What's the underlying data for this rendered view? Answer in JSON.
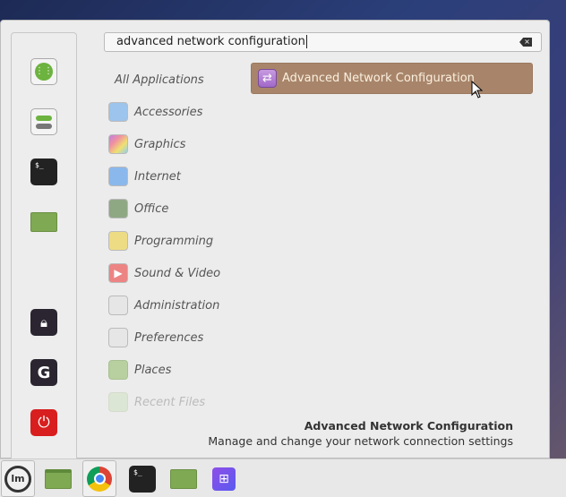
{
  "search": {
    "value": "advanced network configuration"
  },
  "categories": [
    {
      "label": "All Applications",
      "icon": "none"
    },
    {
      "label": "Accessories",
      "icon": "scissors-icon",
      "color": "#9cc4ec"
    },
    {
      "label": "Graphics",
      "icon": "palette-icon",
      "color": "#d890d0"
    },
    {
      "label": "Internet",
      "icon": "cloud-icon",
      "color": "#8ab8ec"
    },
    {
      "label": "Office",
      "icon": "document-icon",
      "color": "#8fa884"
    },
    {
      "label": "Programming",
      "icon": "ruler-icon",
      "color": "#eedc84"
    },
    {
      "label": "Sound & Video",
      "icon": "play-icon",
      "color": "#ec8484"
    },
    {
      "label": "Administration",
      "icon": "toggle-icon",
      "color": "#e6e6e6"
    },
    {
      "label": "Preferences",
      "icon": "toggle-icon",
      "color": "#e6e6e6"
    },
    {
      "label": "Places",
      "icon": "folder-icon",
      "color": "#b8d0a0"
    },
    {
      "label": "Recent Files",
      "icon": "folder-icon",
      "color": "#dce6d4"
    }
  ],
  "result": {
    "label": "Advanced Network Configuration"
  },
  "description": {
    "title": "Advanced Network Configuration",
    "text": "Manage and change your network connection settings"
  }
}
